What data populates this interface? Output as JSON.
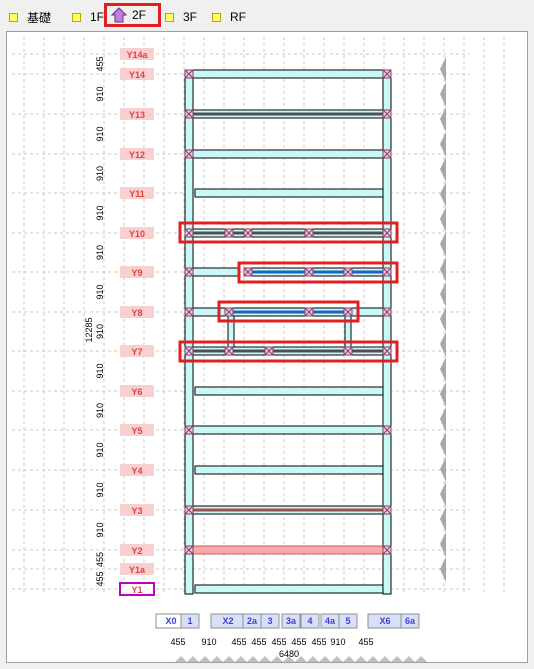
{
  "tabs": [
    {
      "label": "基礎",
      "active": false
    },
    {
      "label": "1F",
      "active": false
    },
    {
      "label": "2F",
      "active": true
    },
    {
      "label": "3F",
      "active": false
    },
    {
      "label": "RF",
      "active": false
    }
  ],
  "active_tab_icon": "house-icon",
  "y_axes": [
    "Y14a",
    "Y14",
    "Y13",
    "Y12",
    "Y11",
    "Y10",
    "Y9",
    "Y8",
    "Y7",
    "Y6",
    "Y5",
    "Y4",
    "Y3",
    "Y2",
    "Y1a",
    "Y1"
  ],
  "selected_y_axis": "Y1",
  "y_dims": [
    "455",
    "910",
    "910",
    "910",
    "910",
    "910",
    "910",
    "910",
    "910",
    "910",
    "910",
    "910",
    "910",
    "455",
    "455"
  ],
  "y_total": "12285",
  "x_axes": [
    "X0",
    "1",
    "X2",
    "2a",
    "3",
    "3a",
    "4",
    "4a",
    "5",
    "X6",
    "6a"
  ],
  "x_dims": [
    "455",
    "910",
    "455",
    "455",
    "455",
    "455",
    "455",
    "910",
    "455"
  ],
  "x_total": "6480",
  "colors": {
    "beam_cyan": "#c8f8f8",
    "beam_red": "#f8a8a8",
    "beam_blue": "#2060c0",
    "highlight": "#e02020",
    "axis_label_bg": "#f8d0d0",
    "axis_label_text": "#e04040",
    "x_label_bg": "#d8e0f8"
  }
}
